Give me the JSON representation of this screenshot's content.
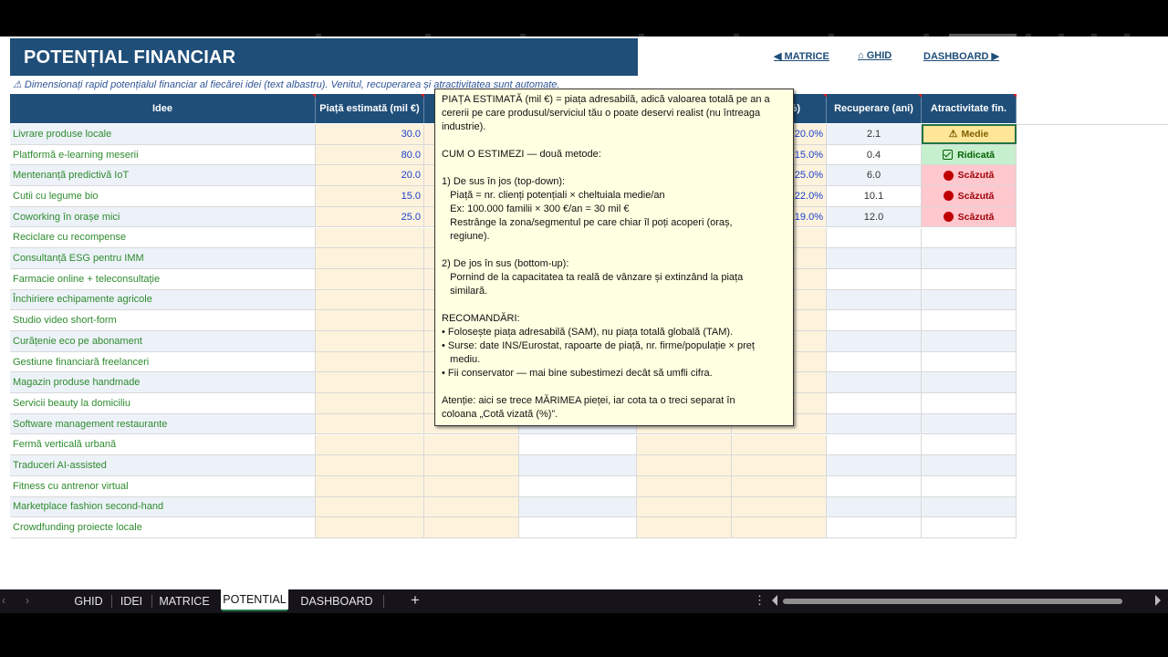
{
  "header": {
    "title": "POTENȚIAL FINANCIAR",
    "subtitle": "⚠ Dimensionați rapid potențialul financiar al fiecărei idei (text albastru). Venitul, recuperarea și atractivitatea sunt automate."
  },
  "nav": {
    "matrice": "◀ MATRICE",
    "ghid": "⌂ GHID",
    "dashboard": "DASHBOARD ▶"
  },
  "columns": {
    "idee": "Idee",
    "piata": "Piață estimată (mil €)",
    "partial_pct": "%)",
    "recuperare": "Recuperare (ani)",
    "atractivitate": "Atractivitate fin."
  },
  "rows": [
    {
      "idee": "Livrare produse locale",
      "piata": "30.0",
      "pct": "20.0%",
      "recuperare": "2.1",
      "atractivitate": "Medie",
      "level": "medie"
    },
    {
      "idee": "Platformă e-learning meserii",
      "piata": "80.0",
      "pct": "15.0%",
      "recuperare": "0.4",
      "atractivitate": "Ridicată",
      "level": "ridicata"
    },
    {
      "idee": "Mentenanță predictivă IoT",
      "piata": "20.0",
      "pct": "25.0%",
      "recuperare": "6.0",
      "atractivitate": "Scăzută",
      "level": "scazuta"
    },
    {
      "idee": "Cutii cu legume bio",
      "piata": "15.0",
      "pct": "22.0%",
      "recuperare": "10.1",
      "atractivitate": "Scăzută",
      "level": "scazuta"
    },
    {
      "idee": "Coworking în orașe mici",
      "piata": "25.0",
      "pct": "19.0%",
      "recuperare": "12.0",
      "atractivitate": "Scăzută",
      "level": "scazuta"
    },
    {
      "idee": "Reciclare cu recompense",
      "piata": "",
      "pct": "",
      "recuperare": "",
      "atractivitate": "",
      "level": ""
    },
    {
      "idee": "Consultanță ESG pentru IMM",
      "piata": "",
      "pct": "",
      "recuperare": "",
      "atractivitate": "",
      "level": ""
    },
    {
      "idee": "Farmacie online + teleconsultație",
      "piata": "",
      "pct": "",
      "recuperare": "",
      "atractivitate": "",
      "level": ""
    },
    {
      "idee": "Închiriere echipamente agricole",
      "piata": "",
      "pct": "",
      "recuperare": "",
      "atractivitate": "",
      "level": ""
    },
    {
      "idee": "Studio video short-form",
      "piata": "",
      "pct": "",
      "recuperare": "",
      "atractivitate": "",
      "level": ""
    },
    {
      "idee": "Curățenie eco pe abonament",
      "piata": "",
      "pct": "",
      "recuperare": "",
      "atractivitate": "",
      "level": ""
    },
    {
      "idee": "Gestiune financiară freelanceri",
      "piata": "",
      "pct": "",
      "recuperare": "",
      "atractivitate": "",
      "level": ""
    },
    {
      "idee": "Magazin produse handmade",
      "piata": "",
      "pct": "",
      "recuperare": "",
      "atractivitate": "",
      "level": ""
    },
    {
      "idee": "Servicii beauty la domiciliu",
      "piata": "",
      "pct": "",
      "recuperare": "",
      "atractivitate": "",
      "level": ""
    },
    {
      "idee": "Software management restaurante",
      "piata": "",
      "pct": "",
      "recuperare": "",
      "atractivitate": "",
      "level": ""
    },
    {
      "idee": "Fermă verticală urbană",
      "piata": "",
      "pct": "",
      "recuperare": "",
      "atractivitate": "",
      "level": ""
    },
    {
      "idee": "Traduceri AI-assisted",
      "piata": "",
      "pct": "",
      "recuperare": "",
      "atractivitate": "",
      "level": ""
    },
    {
      "idee": "Fitness cu antrenor virtual",
      "piata": "",
      "pct": "",
      "recuperare": "",
      "atractivitate": "",
      "level": ""
    },
    {
      "idee": "Marketplace fashion second-hand",
      "piata": "",
      "pct": "",
      "recuperare": "",
      "atractivitate": "",
      "level": ""
    },
    {
      "idee": "Crowdfunding proiecte locale",
      "piata": "",
      "pct": "",
      "recuperare": "",
      "atractivitate": "",
      "level": ""
    }
  ],
  "tooltip": {
    "text": "PIAȚA ESTIMATĂ (mil €) = piața adresabilă, adică valoarea totală pe an a\ncererii pe care produsul/serviciul tău o poate deservi realist (nu întreaga\nindustrie).\n\nCUM O ESTIMEZI — două metode:\n\n1) De sus în jos (top-down):\n   Piață = nr. clienți potențiali × cheltuiala medie/an\n   Ex: 100.000 familii × 300 €/an = 30 mil €\n   Restrânge la zona/segmentul pe care chiar îl poți acoperi (oraș,\n   regiune).\n\n2) De jos în sus (bottom-up):\n   Pornind de la capacitatea ta reală de vânzare și extinzând la piața\n   similară.\n\nRECOMANDĂRI:\n• Folosește piața adresabilă (SAM), nu piața totală globală (TAM).\n• Surse: date INS/Eurostat, rapoarte de piață, nr. firme/populație × preț\n   mediu.\n• Fii conservator — mai bine subestimezi decât să umfli cifra.\n\nAtenție: aici se trece MĂRIMEA pieței, iar cota ta o treci separat în\ncoloana „Cotă vizată (%)”."
  },
  "tabs": {
    "ghid": "GHID",
    "idei": "IDEI",
    "matrice": "MATRICE",
    "potential": "POTENTIAL",
    "dashboard": "DASHBOARD",
    "add": "+",
    "more": "⋮",
    "prev": "‹",
    "next": "›"
  },
  "colors": {
    "header_blue": "#1f4e79",
    "input_blue_text": "#1a3fcf",
    "idea_green_text": "#2e8b2e",
    "input_cell_bg": "#fdf3dc",
    "medie_bg": "#ffe699",
    "ridicata_bg": "#c6efce",
    "scazuta_bg": "#ffc7ce"
  }
}
